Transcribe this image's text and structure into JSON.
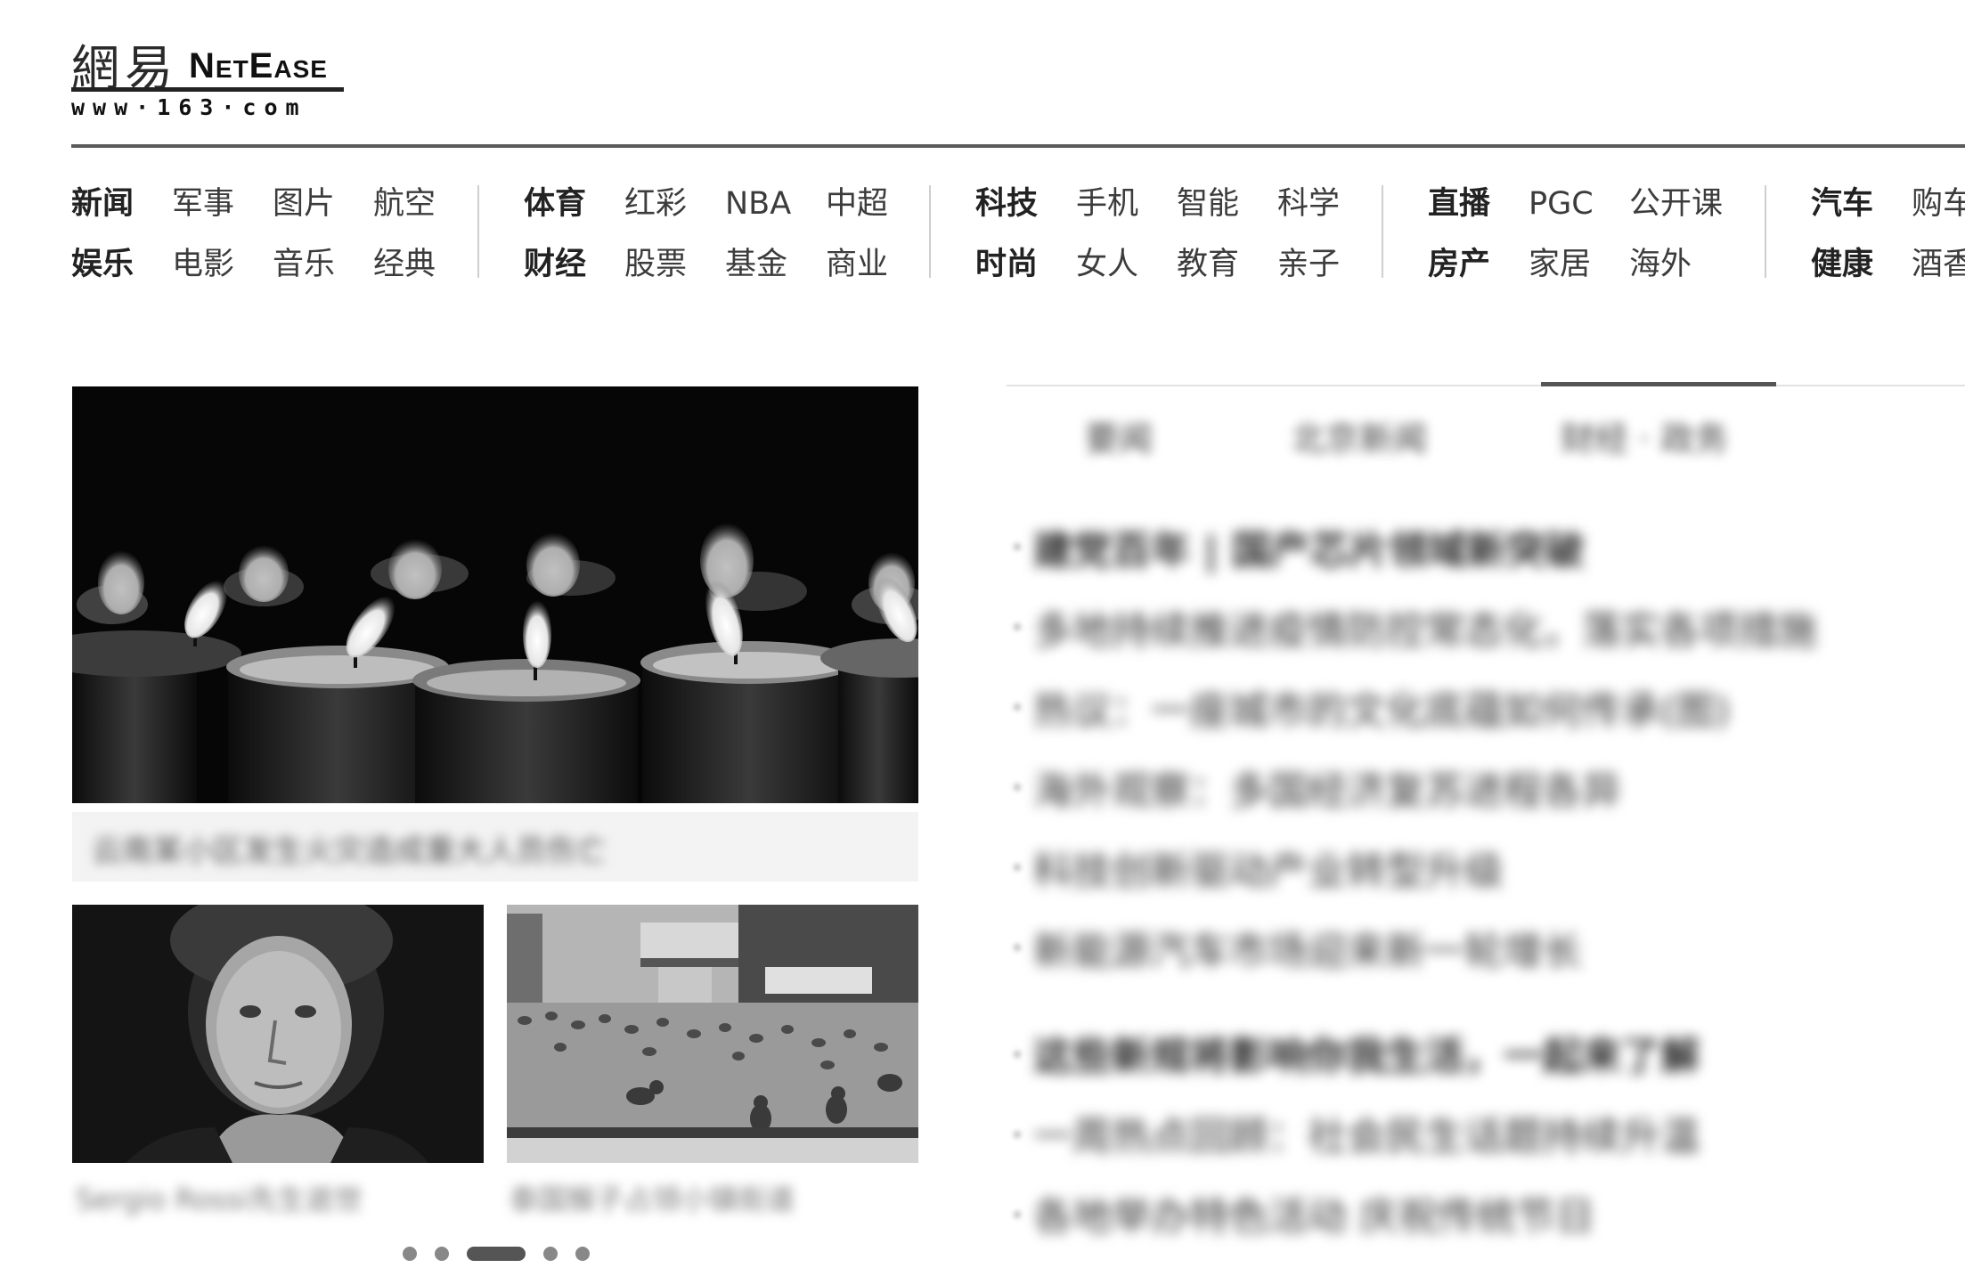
{
  "logo": {
    "cn": "網易",
    "en": "NetEase",
    "url": "www·163·com"
  },
  "nav": {
    "groups": [
      {
        "rows": [
          [
            "新闻",
            "军事",
            "图片",
            "航空"
          ],
          [
            "娱乐",
            "电影",
            "音乐",
            "经典"
          ]
        ]
      },
      {
        "rows": [
          [
            "体育",
            "红彩",
            "NBA",
            "中超"
          ],
          [
            "财经",
            "股票",
            "基金",
            "商业"
          ]
        ]
      },
      {
        "rows": [
          [
            "科技",
            "手机",
            "智能",
            "科学"
          ],
          [
            "时尚",
            "女人",
            "教育",
            "亲子"
          ]
        ]
      },
      {
        "rows": [
          [
            "直播",
            "PGC",
            "公开课"
          ],
          [
            "房产",
            "家居",
            "海外"
          ]
        ]
      },
      {
        "rows": [
          [
            "汽车",
            "购车"
          ],
          [
            "健康",
            "酒香"
          ]
        ]
      }
    ]
  },
  "slider": {
    "caption": "云南某小区发生火灾造成重大人员伤亡",
    "thumb_captions": [
      "Sergio Rossi先生逝世",
      "泰国猴子占领小镇街道"
    ],
    "dot_count": 5,
    "active_dot": 2
  },
  "tabs": [
    "要闻",
    "北京新闻",
    "财经 · 政务"
  ],
  "news": [
    "建党百年 | 国产芯片领域新突破",
    "多地持续推进疫情防控常态化，落实各项措施",
    "热议：一座城市的文化底蕴如何传承(图)",
    "海外观察：多国经济复苏进程各异",
    "科技创新驱动产业转型升级",
    "新能源汽车市场迎来新一轮增长",
    "这些新规将影响你我生活，一起来了解",
    "一周热点回顾：社会民生话题持续升温",
    "各地举办特色活动 庆祝传统节日"
  ]
}
